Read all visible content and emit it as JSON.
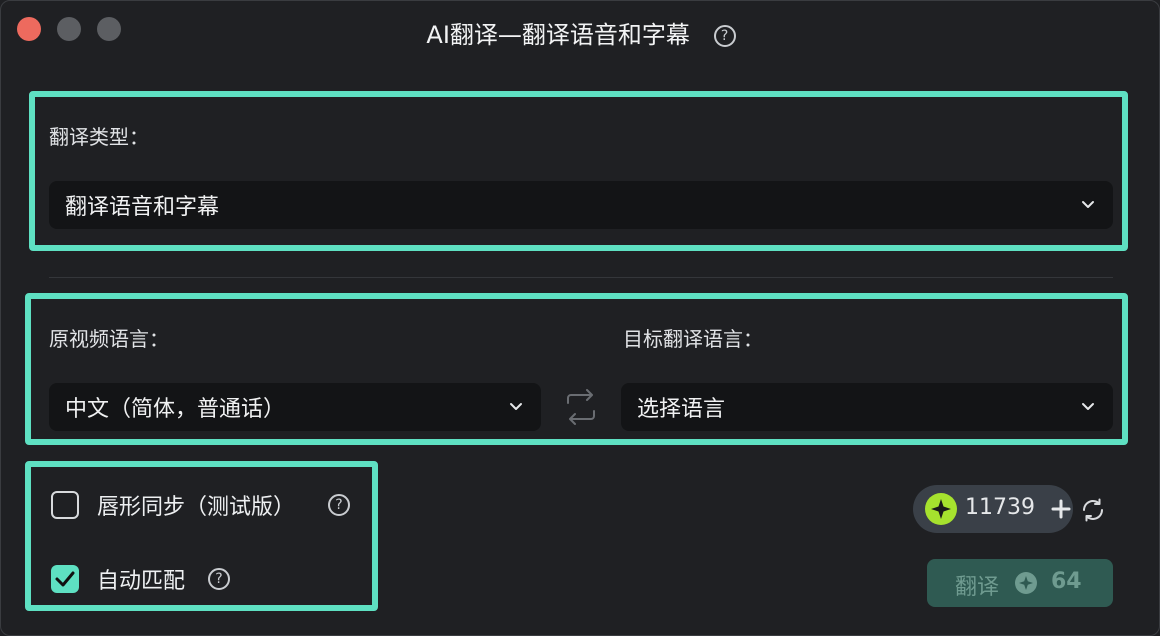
{
  "window": {
    "title": "AI翻译—翻译语音和字幕",
    "help_icon": "?"
  },
  "translation_type": {
    "label": "翻译类型：",
    "selected": "翻译语音和字幕"
  },
  "source_language": {
    "label": "原视频语言：",
    "selected": "中文（简体，普通话）"
  },
  "target_language": {
    "label": "目标翻译语言：",
    "selected": "选择语言"
  },
  "options": {
    "lip_sync": {
      "label": "唇形同步（测试版）",
      "checked": false
    },
    "auto_match": {
      "label": "自动匹配",
      "checked": true
    }
  },
  "credits": {
    "value": "11739"
  },
  "translate_button": {
    "label": "翻译",
    "cost": "64"
  },
  "colors": {
    "accent": "#5ee0c2",
    "background": "#1f2023",
    "field": "#131416",
    "coin": "#a6e22e"
  }
}
